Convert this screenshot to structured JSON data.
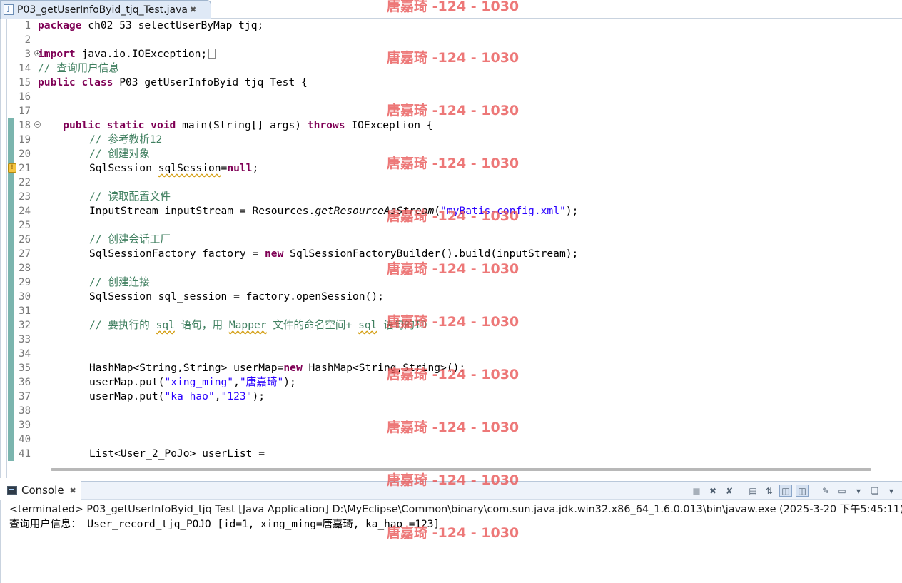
{
  "editor_tab": {
    "icon": "java-file-icon",
    "icon_glyph": "J",
    "label": "P03_getUserInfoByid_tjq_Test.java",
    "close_glyph": "✖"
  },
  "gutter_lines": [
    "1",
    "2",
    "3",
    "14",
    "15",
    "16",
    "17",
    "18",
    "19",
    "20",
    "21",
    "22",
    "23",
    "24",
    "25",
    "26",
    "27",
    "28",
    "29",
    "30",
    "31",
    "32",
    "33",
    "34",
    "35",
    "36",
    "37",
    "38",
    "39",
    "40",
    "41"
  ],
  "code": {
    "l1_kw": "package",
    "l1_rest": " ch02_53_selectUserByMap_tjq;",
    "l3_kw": "import",
    "l3_rest": " java.io.IOException;",
    "l14": "// 查询用户信息",
    "l15_kw": "public class",
    "l15_rest": " P03_getUserInfoByid_tjq_Test {",
    "l18_indent": "    ",
    "l18_kw": "public static void",
    "l18_mid": " main(String[] args) ",
    "l18_kw2": "throws",
    "l18_rest": " IOException {",
    "l19": "// 参考教析12",
    "l20": "// 创建对象",
    "l21_a": "SqlSession ",
    "l21_b": "sqlSession",
    "l21_c": "=",
    "l21_kw": "null",
    "l21_d": ";",
    "l23": "// 读取配置文件",
    "l24_a": "InputStream inputStream = Resources.",
    "l24_b": "getResourceAsStream",
    "l24_c": "(",
    "l24_str": "\"myBatis-config.xml\"",
    "l24_d": ");",
    "l26": "// 创建会话工厂",
    "l27_a": "SqlSessionFactory factory = ",
    "l27_kw": "new",
    "l27_b": " SqlSessionFactoryBuilder().build(inputStream);",
    "l29": "// 创建连接",
    "l30": "SqlSession sql_session = factory.openSession();",
    "l32_a": "// 要执行的 ",
    "l32_b": "sql",
    "l32_c": " 语句，用 ",
    "l32_d": "Mapper",
    "l32_e": " 文件的命名空间+ ",
    "l32_f": "sql",
    "l32_g": " 语句的ID",
    "l35_a": "HashMap<String,String> userMap=",
    "l35_kw": "new",
    "l35_b": " HashMap<String,String>();",
    "l36_a": "userMap.put(",
    "l36_s1": "\"xing_ming\"",
    "l36_b": ",",
    "l36_s2": "\"唐嘉琦\"",
    "l36_c": ");",
    "l37_a": "userMap.put(",
    "l37_s1": "\"ka_hao\"",
    "l37_b": ",",
    "l37_s2": "\"123\"",
    "l37_c": ");",
    "l41": "List<User_2_PoJo> userList ="
  },
  "console": {
    "tab_label": "Console",
    "close_glyph": "✖",
    "toolbar_icons": [
      "terminate-icon",
      "remove-launch-icon",
      "remove-all-terminated-icon",
      "clear-console-icon",
      "scroll-lock-icon",
      "word-wrap-icon",
      "show-on-stdout-icon",
      "show-on-stderr-icon",
      "pin-console-icon",
      "display-selected-console-icon",
      "open-console-icon"
    ],
    "terminated_line": "<terminated> P03_getUserInfoByid_tjq Test [Java Application] D:\\MyEclipse\\Common\\binary\\com.sun.java.jdk.win32.x86_64_1.6.0.013\\bin\\javaw.exe (2025-3-20 下午5:45:11)",
    "output_line": "查询用户信息： User_record_tjq_POJO [id=1, xing_ming=唐嘉琦, ka_hao =123]"
  },
  "watermark": {
    "text": "唐嘉琦 -124 - 1030",
    "color": "#e85252"
  }
}
